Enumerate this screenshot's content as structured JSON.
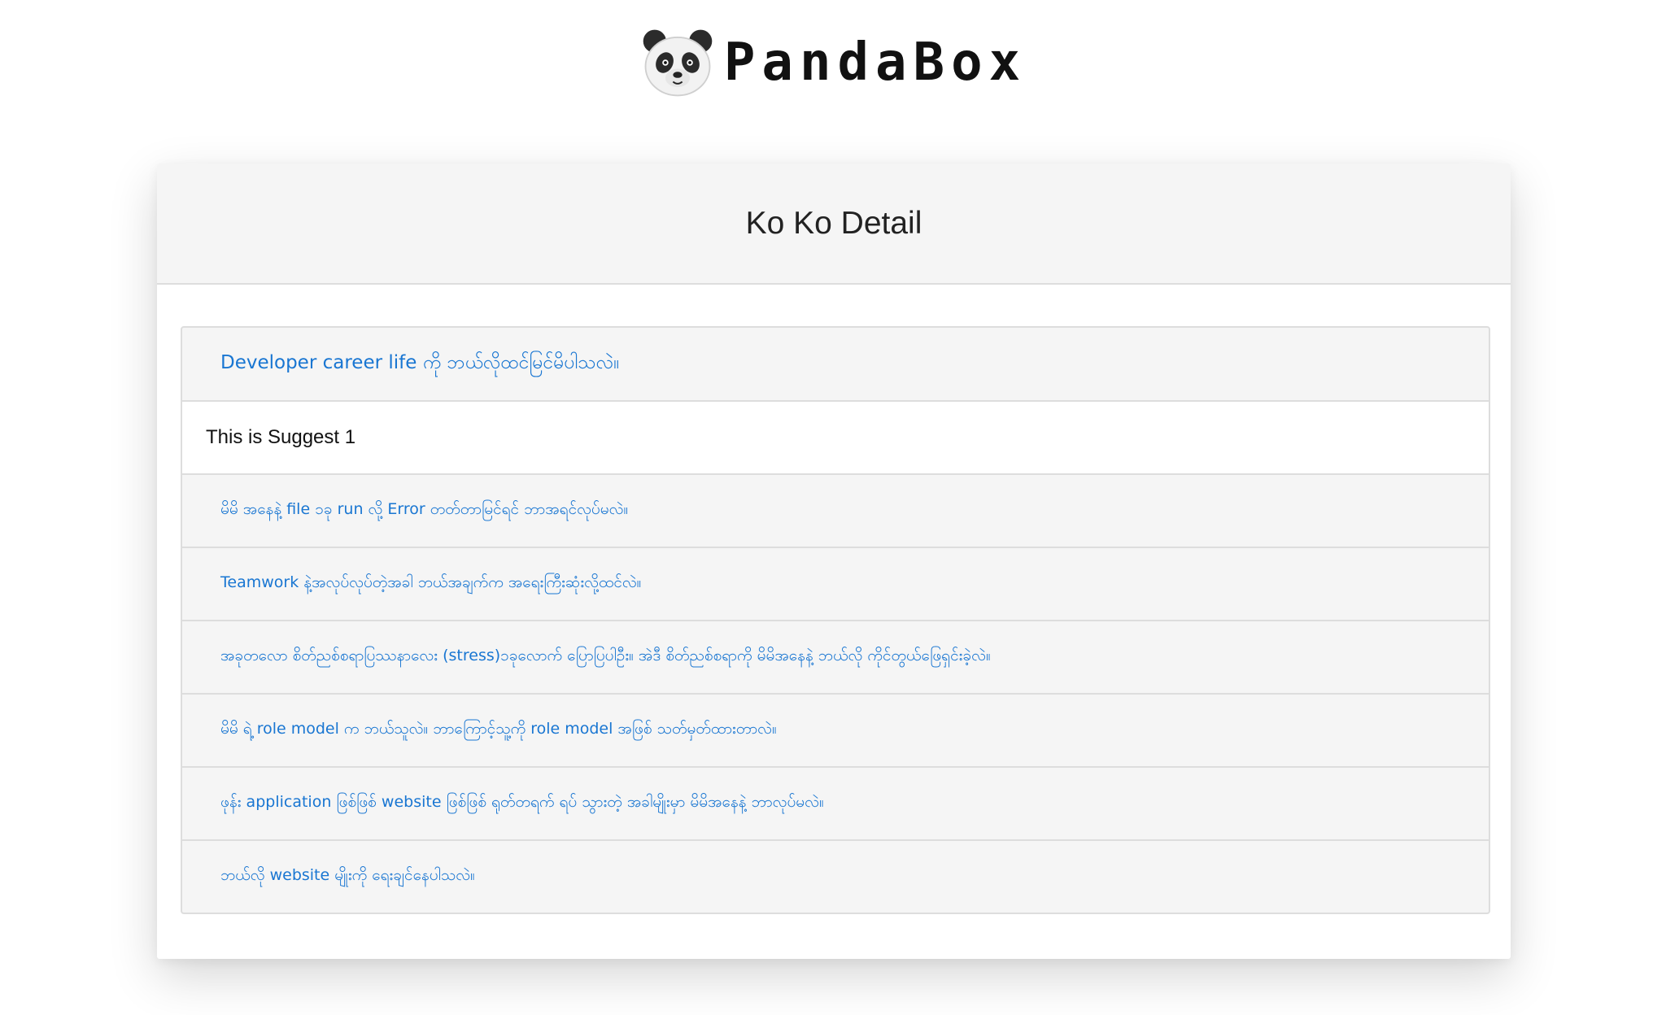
{
  "brand": {
    "name": "PandaBox",
    "icon": "panda-face-icon"
  },
  "card": {
    "title": "Ko Ko Detail"
  },
  "questions": [
    {
      "label": "Developer career life ကို ဘယ်လိုထင်မြင်မိပါသလဲ။"
    },
    {
      "suggest": "This is Suggest 1"
    },
    {
      "label": "မိမိ အနေနဲ့ file ၁ခု run လို့ Error တတ်တာမြင်ရင် ဘာအရင်လုပ်မလဲ။"
    },
    {
      "label": "Teamwork နဲ့အလုပ်လုပ်တဲ့အခါ ဘယ်အချက်က အရေးကြီးဆုံးလို့ထင်လဲ။"
    },
    {
      "label": "အခုတလော စိတ်ညစ်စရာပြဿနာလေး (stress)၁ခုလောက် ပြောပြပါဦး။ အဲဒီ စိတ်ညစ်စရာကို မိမိအနေနဲ့ ဘယ်လို ကိုင်တွယ်ဖြေရှင်းခဲ့လဲ။"
    },
    {
      "label": "မိမိ ရဲ့ role model က ဘယ်သူလဲ။ ဘာကြောင့်သူ့ကို role model အဖြစ် သတ်မှတ်ထားတာလဲ။"
    },
    {
      "label": "ဖုန်း application ဖြစ်ဖြစ် website ဖြစ်ဖြစ် ရုတ်တရက် ရပ် သွားတဲ့ အခါမျိုးမှာ မိမိအနေနဲ့ ဘာလုပ်မလဲ။"
    },
    {
      "label": "ဘယ်လို website မျိုးကို ရေးချင်နေပါသလဲ။"
    }
  ],
  "colors": {
    "link": "#1976d2",
    "header_bg": "#f5f5f5",
    "border": "#dddddd"
  }
}
